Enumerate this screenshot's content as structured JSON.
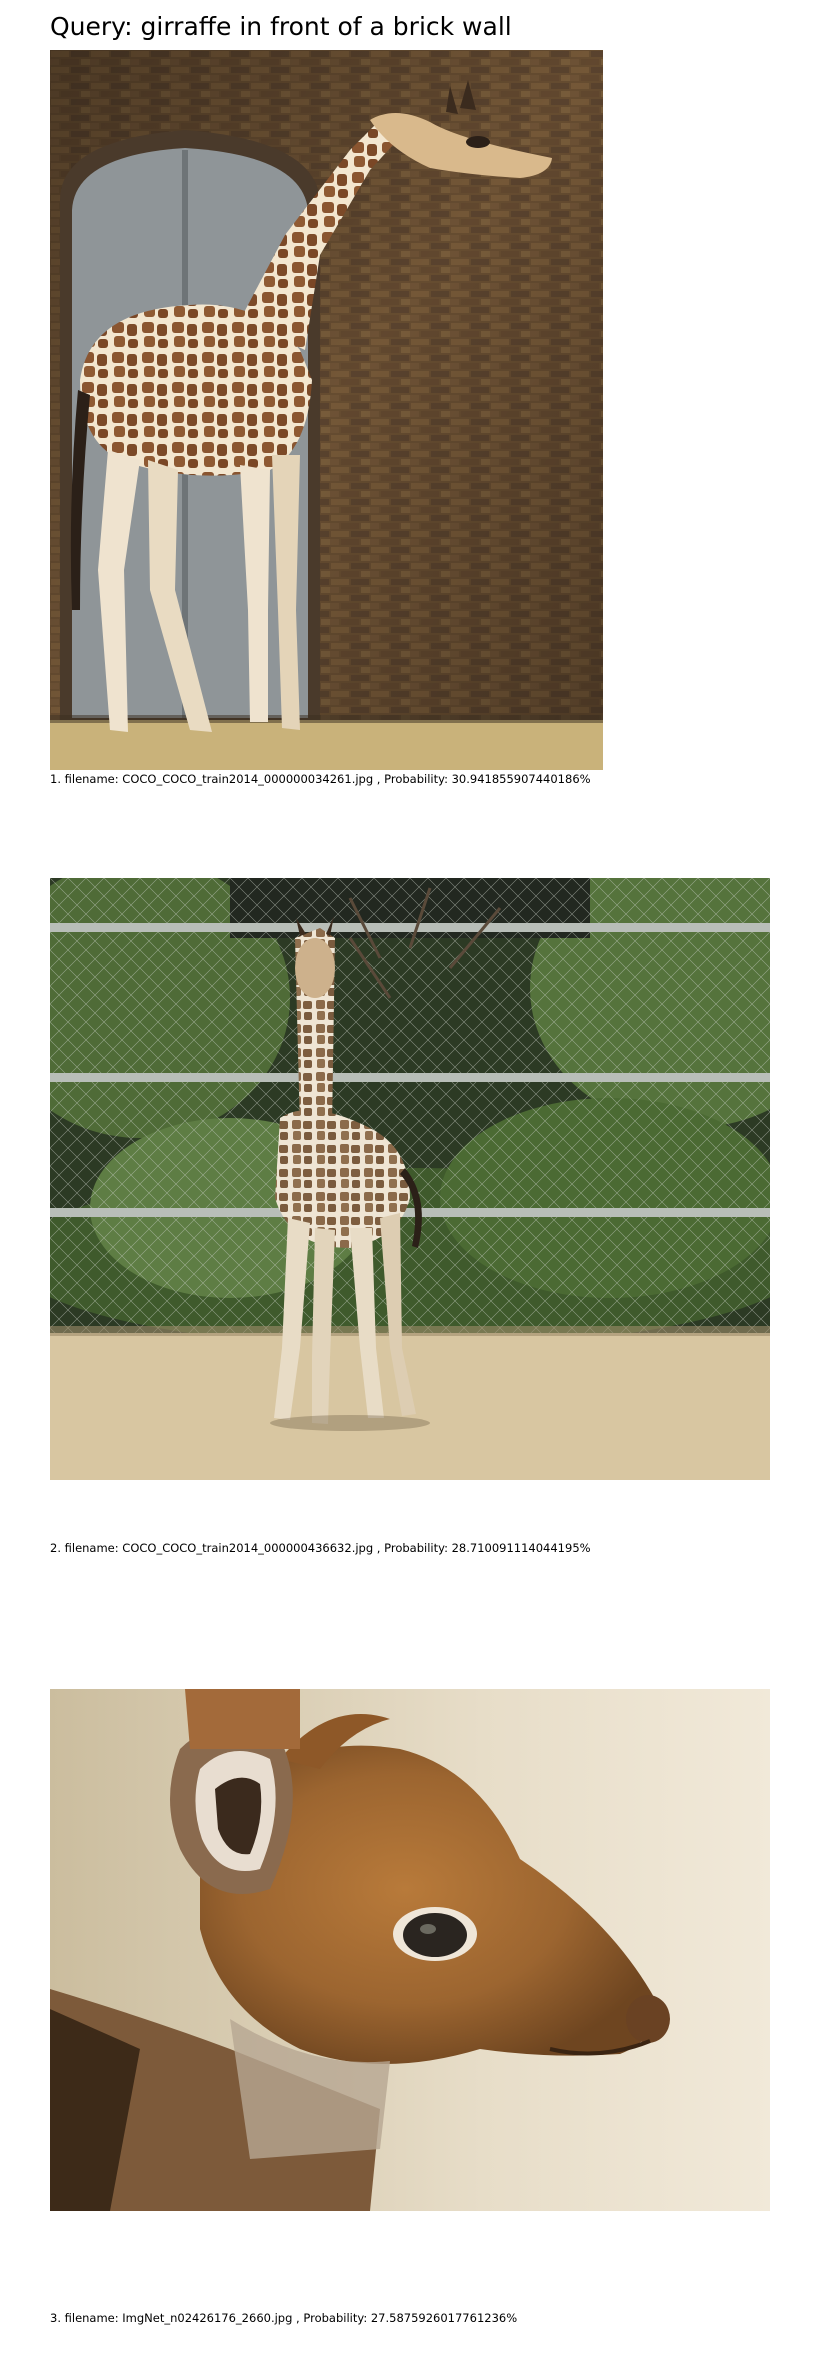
{
  "query": {
    "title": "Query: girraffe in front of a brick wall"
  },
  "results": [
    {
      "caption": "1. filename: COCO_COCO_train2014_000000034261.jpg , Probability: 30.941855907440186%"
    },
    {
      "caption": "2. filename: COCO_COCO_train2014_000000436632.jpg , Probability: 28.710091114044195%"
    },
    {
      "caption": "3. filename: ImgNet_n02426176_2660.jpg , Probability: 27.5875926017761236%"
    }
  ]
}
